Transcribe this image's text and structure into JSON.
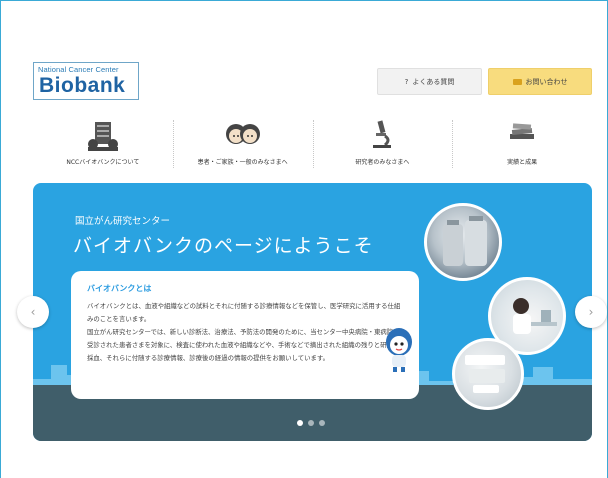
{
  "header": {
    "logo": {
      "top_line": "National Cancer Center",
      "name": "Biobank"
    },
    "faq_button": {
      "icon": "?",
      "label": "よくある質問"
    },
    "contact_button": {
      "icon": "mail-icon",
      "label": "お問い合わせ"
    }
  },
  "nav": {
    "items": [
      {
        "label": "NCCバイオバンクについて",
        "icon": "biobank-building-icon"
      },
      {
        "label": "患者・ご家族・一般のみなさまへ",
        "icon": "family-icon"
      },
      {
        "label": "研究者のみなさまへ",
        "icon": "microscope-icon"
      },
      {
        "label": "実績と成果",
        "icon": "books-icon"
      }
    ]
  },
  "hero": {
    "subtitle": "国立がん研究センター",
    "title": "バイオバンクのページにようこそ",
    "card": {
      "title": "バイオバンクとは",
      "paragraphs": [
        "バイオバンクとは、血液や組織などの試料とそれに付随する診療情報などを保管し、医学研究に活用する仕組みのことを言います。",
        "国立がん研究センターでは、新しい診断法、治療法、予防法の開発のために、当センター中央病院・東病院に受診された患者さまを対象に、検査に使われた血液や組織などや、手術などで摘出された組織の残りと研究用採血、それらに付随する診療情報、診療後の経過の情報の提供をお願いしています。"
      ]
    },
    "slides": {
      "count": 3,
      "active": 1
    }
  },
  "carousel": {
    "prev_icon": "‹",
    "next_icon": "›"
  },
  "colors": {
    "hero_bg": "#2aa3e1",
    "hero_ground": "#405e6a",
    "contact_bg": "#f8dc7e",
    "accent": "#2a9be0"
  }
}
